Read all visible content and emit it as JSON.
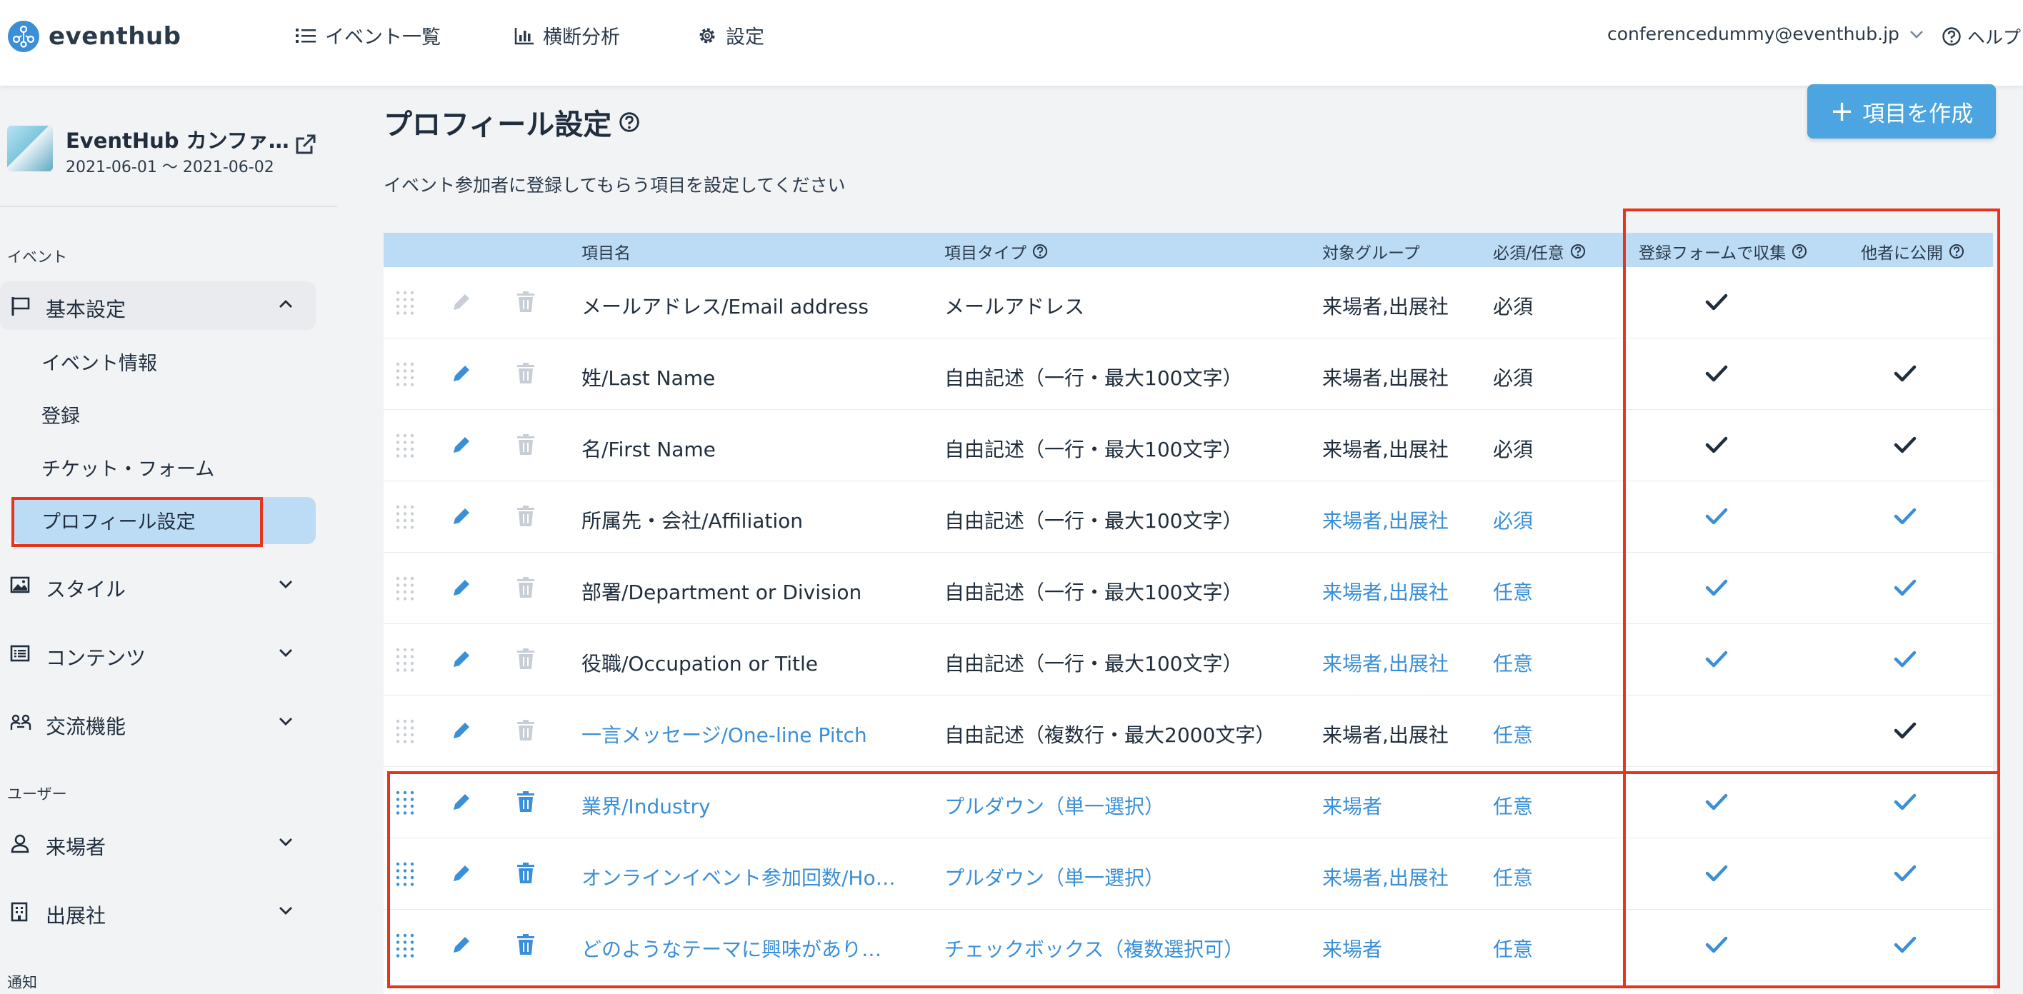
{
  "app": {
    "logo_text": "eventhub"
  },
  "nav": {
    "items": [
      {
        "label": "イベント一覧",
        "icon": "list-icon"
      },
      {
        "label": "横断分析",
        "icon": "bar-chart-icon"
      },
      {
        "label": "設定",
        "icon": "gear-icon"
      }
    ],
    "user_email": "conferencedummy@eventhub.jp",
    "help_label": "ヘルプ"
  },
  "sidebar": {
    "event_name": "EventHub カンファ…",
    "event_dates": "2021-06-01 ～ 2021-06-02",
    "section_event": "イベント",
    "basic_settings": "基本設定",
    "sub_items": [
      "イベント情報",
      "登録",
      "チケット・フォーム",
      "プロフィール設定"
    ],
    "style": "スタイル",
    "contents": "コンテンツ",
    "networking": "交流機能",
    "section_user": "ユーザー",
    "visitors": "来場者",
    "exhibitors": "出展社",
    "section_notify": "通知"
  },
  "main": {
    "title": "プロフィール設定",
    "create_button": "項目を作成",
    "description": "イベント参加者に登録してもらう項目を設定してください"
  },
  "table": {
    "headers": {
      "name": "項目名",
      "type": "項目タイプ",
      "group": "対象グループ",
      "required": "必須/任意",
      "collect": "登録フォームで収集",
      "public": "他者に公開"
    },
    "rows": [
      {
        "name": "メールアドレス/Email address",
        "type": "メールアドレス",
        "group": "来場者,出展社",
        "required": "必須",
        "collect": true,
        "public": false,
        "style": "dark",
        "editable": false,
        "deletable": false,
        "check_color": "#1f2d3d"
      },
      {
        "name": "姓/Last Name",
        "type": "自由記述（一行・最大100文字）",
        "group": "来場者,出展社",
        "required": "必須",
        "collect": true,
        "public": true,
        "style": "dark",
        "editable": true,
        "deletable": false,
        "check_color": "#1f2d3d"
      },
      {
        "name": "名/First Name",
        "type": "自由記述（一行・最大100文字）",
        "group": "来場者,出展社",
        "required": "必須",
        "collect": true,
        "public": true,
        "style": "dark",
        "editable": true,
        "deletable": false,
        "check_color": "#1f2d3d"
      },
      {
        "name": "所属先・会社/Affiliation",
        "type": "自由記述（一行・最大100文字）",
        "group": "来場者,出展社",
        "required": "必須",
        "collect": true,
        "public": true,
        "style": "mixed",
        "editable": true,
        "deletable": false,
        "check_color": "#3a8fd6"
      },
      {
        "name": "部署/Department or Division",
        "type": "自由記述（一行・最大100文字）",
        "group": "来場者,出展社",
        "required": "任意",
        "collect": true,
        "public": true,
        "style": "mixed",
        "editable": true,
        "deletable": false,
        "check_color": "#3a8fd6"
      },
      {
        "name": "役職/Occupation or Title",
        "type": "自由記述（一行・最大100文字）",
        "group": "来場者,出展社",
        "required": "任意",
        "collect": true,
        "public": true,
        "style": "mixed",
        "editable": true,
        "deletable": false,
        "check_color": "#3a8fd6"
      },
      {
        "name": "一言メッセージ/One-line Pitch",
        "type": "自由記述（複数行・最大2000文字）",
        "group": "来場者,出展社",
        "required": "任意",
        "collect": false,
        "public": true,
        "style": "pitch",
        "editable": true,
        "deletable": false,
        "check_color": "#1f2d3d"
      },
      {
        "name": "業界/Industry",
        "type": "プルダウン（単一選択）",
        "group": "来場者",
        "required": "任意",
        "collect": true,
        "public": true,
        "style": "link",
        "editable": true,
        "deletable": true,
        "check_color": "#3a8fd6"
      },
      {
        "name": "オンラインイベント参加回数/Ho…",
        "type": "プルダウン（単一選択）",
        "group": "来場者,出展社",
        "required": "任意",
        "collect": true,
        "public": true,
        "style": "link",
        "editable": true,
        "deletable": true,
        "check_color": "#3a8fd6"
      },
      {
        "name": "どのようなテーマに興味があり…",
        "type": "チェックボックス（複数選択可）",
        "group": "来場者",
        "required": "任意",
        "collect": true,
        "public": true,
        "style": "link",
        "editable": true,
        "deletable": true,
        "check_color": "#3a8fd6"
      }
    ]
  },
  "colors": {
    "accent": "#3a8fd6",
    "header_bg": "#bcdcf5",
    "button_bg": "#4ca5e0",
    "highlight": "#e8341c"
  }
}
